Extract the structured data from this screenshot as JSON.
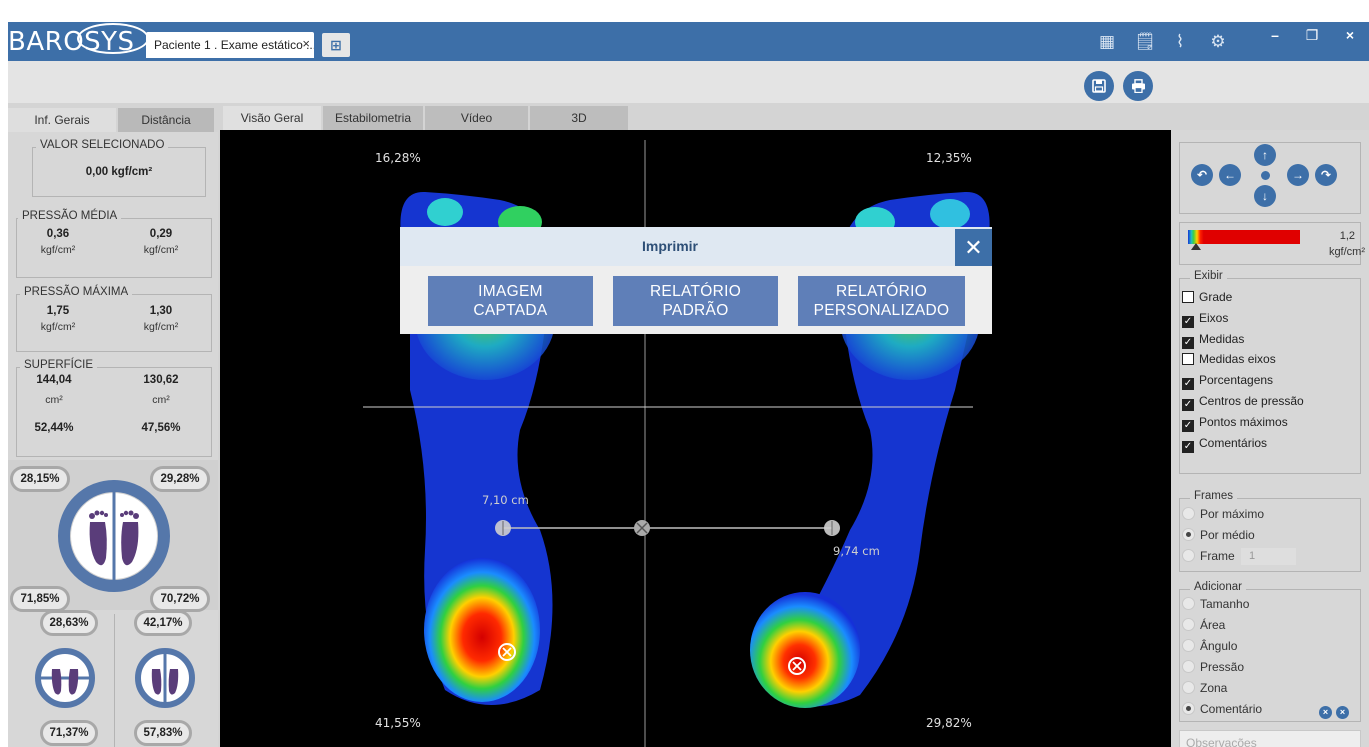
{
  "app": {
    "logo": "BAROSYS"
  },
  "titlebar": {
    "doc_tab": "Paciente 1 . Exame estático ...",
    "doc_tab_close": "×",
    "new_tab_icon": "⊞",
    "icons": [
      "grid-icon",
      "report-icon",
      "chart-icon",
      "settings-icon"
    ],
    "minimize": "–",
    "restore": "❐",
    "close": "×"
  },
  "toolbar": {
    "save_icon": "💾",
    "print_icon": "🖶"
  },
  "left_tabs": [
    "Inf. Gerais",
    "Distância"
  ],
  "main_tabs": [
    "Visão Geral",
    "Estabilometria",
    "Vídeo",
    "3D"
  ],
  "left": {
    "selected": {
      "title": "VALOR SELECIONADO",
      "value": "0,00 kgf/cm²"
    },
    "avg_pressure": {
      "title": "PRESSÃO MÉDIA",
      "left": "0,36",
      "right": "0,29",
      "unit": "kgf/cm²"
    },
    "max_pressure": {
      "title": "PRESSÃO MÁXIMA",
      "left": "1,75",
      "right": "1,30",
      "unit": "kgf/cm²"
    },
    "surface": {
      "title": "SUPERFÍCIE",
      "left": "144,04",
      "right": "130,62",
      "unit": "cm²",
      "left_pct": "52,44%",
      "right_pct": "47,56%"
    },
    "feet_top": [
      "28,15%",
      "29,28%"
    ],
    "feet_bottom": [
      "71,85%",
      "70,72%"
    ],
    "small_top": [
      "28,63%",
      "42,17%"
    ],
    "small_bottom": [
      "71,37%",
      "57,83%"
    ]
  },
  "main": {
    "pct_tl": "16,28%",
    "pct_tr": "12,35%",
    "pct_bl": "41,55%",
    "pct_br": "29,82%",
    "measure_left": "7,10 cm",
    "measure_right": "9,74 cm"
  },
  "dialog": {
    "title": "Imprimir",
    "close": "✕",
    "btn1": [
      "IMAGEM",
      "CAPTADA"
    ],
    "btn2": [
      "RELATÓRIO",
      "PADRÃO"
    ],
    "btn3": [
      "RELATÓRIO",
      "PERSONALIZADO"
    ]
  },
  "right": {
    "scale_value": "1,2",
    "scale_unit": "kgf/cm²",
    "exibir_title": "Exibir",
    "exibir": [
      {
        "label": "Grade",
        "checked": false
      },
      {
        "label": "Eixos",
        "checked": true
      },
      {
        "label": "Medidas",
        "checked": true
      },
      {
        "label": "Medidas eixos",
        "checked": false
      },
      {
        "label": "Porcentagens",
        "checked": true
      },
      {
        "label": "Centros de pressão",
        "checked": true
      },
      {
        "label": "Pontos máximos",
        "checked": true
      },
      {
        "label": "Comentários",
        "checked": true
      }
    ],
    "frames_title": "Frames",
    "frames": [
      {
        "label": "Por máximo",
        "selected": false
      },
      {
        "label": "Por médio",
        "selected": true
      },
      {
        "label": "Frame",
        "selected": false
      }
    ],
    "frame_value": "1",
    "adicionar_title": "Adicionar",
    "adicionar": [
      {
        "label": "Tamanho",
        "selected": false
      },
      {
        "label": "Área",
        "selected": false
      },
      {
        "label": "Ângulo",
        "selected": false
      },
      {
        "label": "Pressão",
        "selected": false
      },
      {
        "label": "Zona",
        "selected": false
      },
      {
        "label": "Comentário",
        "selected": true
      }
    ],
    "observations_placeholder": "Observações"
  },
  "colors": {
    "accent": "#3d6fa8",
    "dialog_button": "#5f7fb8",
    "panel": "#d7d7d7",
    "view_bg": "#000000"
  }
}
